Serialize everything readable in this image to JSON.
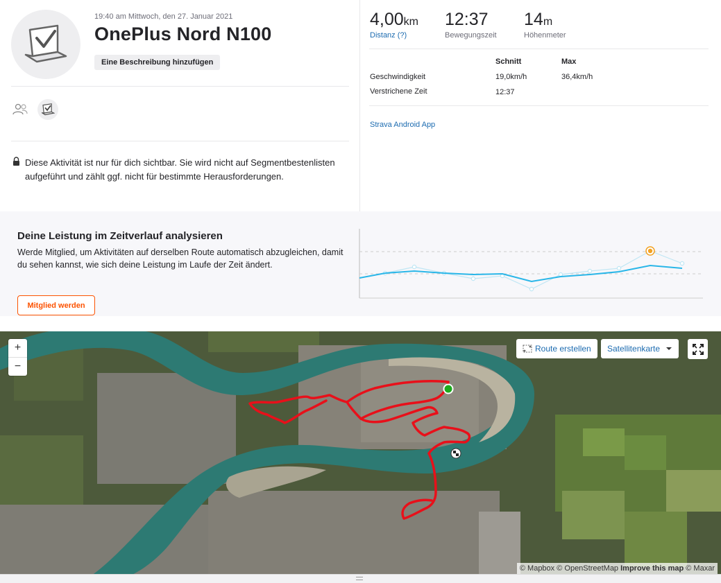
{
  "activity": {
    "datetime": "19:40 am Mittwoch, den 27. Januar 2021",
    "title": "OnePlus Nord N100",
    "add_description_label": "Eine Beschreibung hinzufügen",
    "privacy_notice": "Diese Aktivität ist nur für dich sichtbar. Sie wird nicht auf Segmentbestenlisten aufgeführt und zählt ggf. nicht für bestimmte Herausforderungen."
  },
  "stats": {
    "distance": {
      "value": "4,00",
      "unit": "km",
      "label": "Distanz (?)"
    },
    "moving_time": {
      "value": "12:37",
      "label": "Bewegungszeit"
    },
    "elevation": {
      "value": "14",
      "unit": "m",
      "label": "Höhenmeter"
    }
  },
  "details_table": {
    "headers": [
      "Schnitt",
      "Max"
    ],
    "rows": [
      {
        "label": "Geschwindigkeit",
        "avg": "19,0km/h",
        "max": "36,4km/h"
      },
      {
        "label": "Verstrichene Zeit",
        "avg": "12:37",
        "max": ""
      }
    ]
  },
  "device": "Strava Android App",
  "performance": {
    "title": "Deine Leistung im Zeitverlauf analysieren",
    "text": "Werde Mitglied, um Aktivitäten auf derselben Route automatisch abzugleichen, damit du sehen kannst, wie sich deine Leistung im Laufe der Zeit ändert.",
    "cta_label": "Mitglied werden"
  },
  "map": {
    "zoom_in": "+",
    "zoom_out": "−",
    "route_label": "Route erstellen",
    "map_type_label": "Satellitenkarte",
    "attribution": {
      "mapbox": "© Mapbox",
      "osm": "© OpenStreetMap",
      "improve": "Improve this map",
      "maxar": "© Maxar"
    }
  },
  "colors": {
    "brand": "#fc5200",
    "link": "#1c6bb0",
    "route": "#e8101a",
    "start": "#1bab1b",
    "trend_line": "#29b6e8"
  }
}
